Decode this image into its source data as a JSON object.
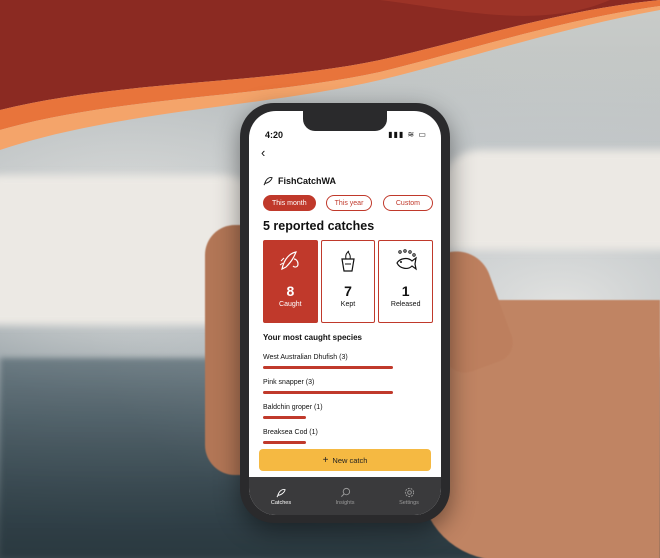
{
  "status": {
    "time": "4:20",
    "icons": "▮▮▮ ≋ ▭"
  },
  "nav": {
    "back_glyph": "‹"
  },
  "brand": {
    "name": "FishCatchWA",
    "icon": "fish-icon"
  },
  "filters": [
    {
      "label": "This month",
      "active": true
    },
    {
      "label": "This year",
      "active": false
    },
    {
      "label": "Custom",
      "active": false
    }
  ],
  "summary": {
    "headline": "5 reported catches"
  },
  "cards": [
    {
      "value": "8",
      "label": "Caught",
      "icon": "fish-hook-icon",
      "active": true
    },
    {
      "value": "7",
      "label": "Kept",
      "icon": "bucket-icon",
      "active": false
    },
    {
      "value": "1",
      "label": "Released",
      "icon": "released-fish-icon",
      "active": false
    }
  ],
  "species_section": {
    "title": "Your most caught species",
    "items": [
      {
        "name": "West Australian Dhufish (3)",
        "count": 3
      },
      {
        "name": "Pink snapper (3)",
        "count": 3
      },
      {
        "name": "Baldchin groper (1)",
        "count": 1
      },
      {
        "name": "Breaksea Cod (1)",
        "count": 1
      }
    ]
  },
  "cta": {
    "icon": "+",
    "label": "New catch"
  },
  "tabbar": [
    {
      "label": "Catches",
      "icon": "fish-icon",
      "active": true
    },
    {
      "label": "Insights",
      "icon": "insights-icon",
      "active": false
    },
    {
      "label": "Settings",
      "icon": "gear-icon",
      "active": false
    }
  ],
  "colors": {
    "accent": "#c0392b",
    "cta": "#f5b942",
    "banner_dark": "#8b2a22",
    "banner_orange": "#e8743b"
  }
}
